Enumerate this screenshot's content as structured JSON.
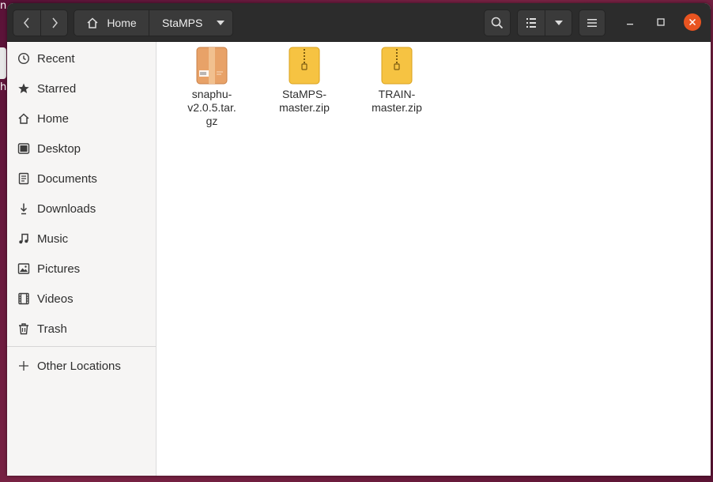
{
  "desktop": {
    "partial_label_top": "n",
    "partial_label_bottom": "h"
  },
  "path_bar": {
    "home": "Home",
    "current": "StaMPS"
  },
  "sidebar": {
    "items": [
      {
        "label": "Recent",
        "icon": "clock-icon"
      },
      {
        "label": "Starred",
        "icon": "star-icon"
      },
      {
        "label": "Home",
        "icon": "home-icon"
      },
      {
        "label": "Desktop",
        "icon": "desktop-icon"
      },
      {
        "label": "Documents",
        "icon": "document-icon"
      },
      {
        "label": "Downloads",
        "icon": "download-icon"
      },
      {
        "label": "Music",
        "icon": "music-icon"
      },
      {
        "label": "Pictures",
        "icon": "picture-icon"
      },
      {
        "label": "Videos",
        "icon": "video-icon"
      },
      {
        "label": "Trash",
        "icon": "trash-icon"
      }
    ],
    "other_locations": "Other Locations"
  },
  "files": [
    {
      "name": "snaphu-v2.0.5.tar.gz",
      "display": "snaphu-\nv2.0.5.tar.\ngz",
      "icon": "archive-icon"
    },
    {
      "name": "StaMPS-master.zip",
      "display": "StaMPS-\nmaster.zip",
      "icon": "zip-icon"
    },
    {
      "name": "TRAIN-master.zip",
      "display": "TRAIN-\nmaster.zip",
      "icon": "zip-icon"
    }
  ],
  "colors": {
    "close_button": "#e95420",
    "zip": "#f6c342",
    "archive": "#e8a268"
  }
}
